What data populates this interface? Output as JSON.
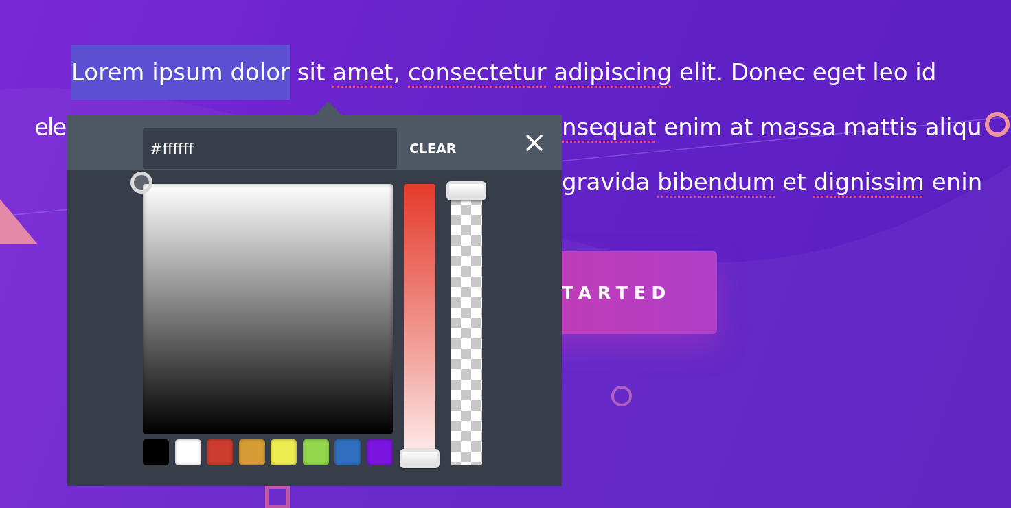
{
  "text_lines": [
    {
      "kind": "indented",
      "fragments": [
        {
          "segments": [
            {
              "text": "Lorem ipsum dolor",
              "selected": true,
              "misspelled": false
            },
            {
              "text": " sit ",
              "selected": false,
              "misspelled": false
            },
            {
              "text": "amet",
              "selected": false,
              "misspelled": true
            },
            {
              "text": ", ",
              "selected": false,
              "misspelled": false
            },
            {
              "text": "consectetur",
              "selected": false,
              "misspelled": true
            },
            {
              "text": " adipiscing",
              "selected": false,
              "misspelled": true
            },
            {
              "text": " elit. Donec eget leo id",
              "selected": false,
              "misspelled": false
            }
          ]
        }
      ]
    },
    {
      "kind": "split",
      "fragments": [
        {
          "segments": [
            {
              "text": "ele",
              "selected": false,
              "misspelled": false
            }
          ]
        },
        {
          "segments": [
            {
              "text": "nsequat",
              "selected": false,
              "misspelled": true
            },
            {
              "text": " enim at massa mattis aliqu",
              "selected": false,
              "misspelled": false
            }
          ]
        }
      ]
    },
    {
      "kind": "tail",
      "fragments": [
        {
          "segments": [
            {
              "text": "gravida ",
              "selected": false,
              "misspelled": false
            },
            {
              "text": "bibendum",
              "selected": false,
              "misspelled": true
            },
            {
              "text": " et ",
              "selected": false,
              "misspelled": false
            },
            {
              "text": "dignissim",
              "selected": false,
              "misspelled": true
            },
            {
              "text": " enin",
              "selected": false,
              "misspelled": false
            }
          ]
        }
      ]
    }
  ],
  "cta_button": {
    "label": "TARTED"
  },
  "color_picker": {
    "hex_field": {
      "value": "#ffffff"
    },
    "clear_button": "CLEAR",
    "hue_slider": {
      "level": 0
    },
    "alpha_slider": {
      "level": 1
    },
    "swatches": [
      {
        "color": "#000000"
      },
      {
        "color": "#ffffff"
      },
      {
        "color": "#cc3b2e"
      },
      {
        "color": "#d69c36"
      },
      {
        "color": "#eeec50"
      },
      {
        "color": "#92d64c"
      },
      {
        "color": "#2f6fbd"
      },
      {
        "color": "#7a14de"
      }
    ]
  }
}
